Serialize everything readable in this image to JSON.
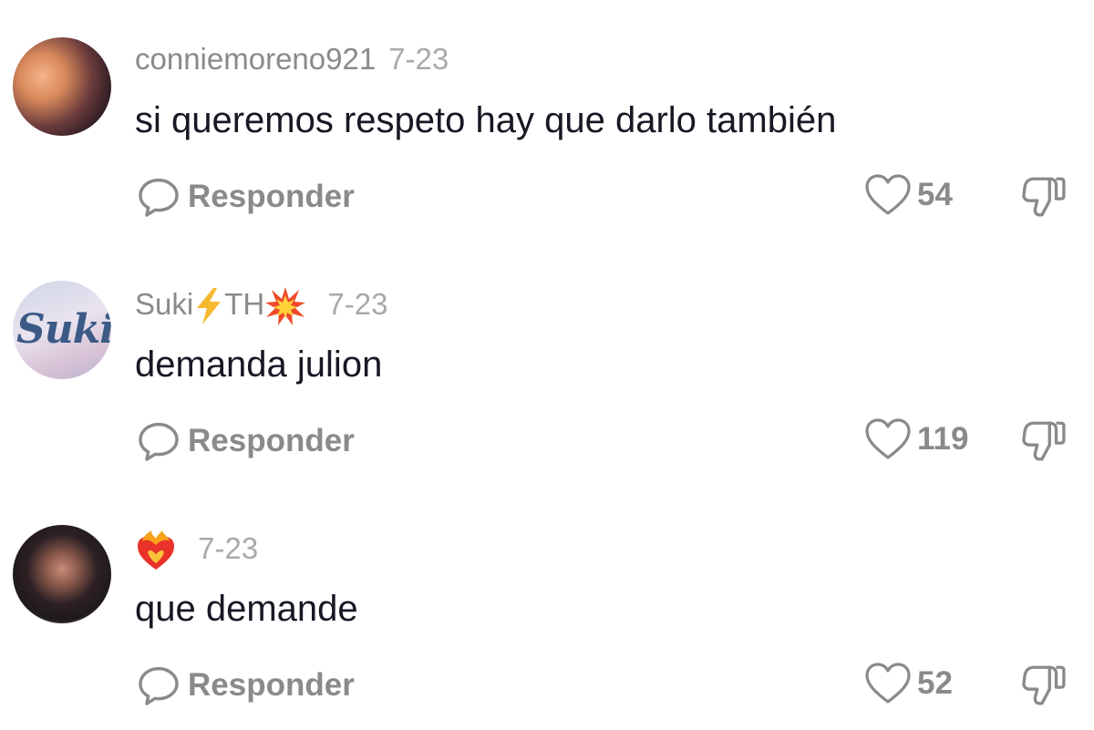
{
  "comments": [
    {
      "username": "conniemoreno921",
      "date": "7-23",
      "text": "si queremos respeto hay que darlo también",
      "reply_label": "Responder",
      "likes": "54",
      "avatar": "profile-photo-three-women"
    },
    {
      "username": "Suki",
      "username_suffix": "TH",
      "date": "7-23",
      "text": "demanda julion",
      "reply_label": "Responder",
      "likes": "119",
      "avatar_text": "Suki"
    },
    {
      "username": "",
      "date": "7-23",
      "text": "que demande",
      "reply_label": "Responder",
      "likes": "52",
      "avatar": "profile-photo-woman"
    }
  ],
  "icons": {
    "reply": "speech-bubble-icon",
    "like": "heart-outline-icon",
    "dislike": "thumbs-down-icon"
  },
  "colors": {
    "text": "#161823",
    "muted": "#8a8a8a"
  }
}
